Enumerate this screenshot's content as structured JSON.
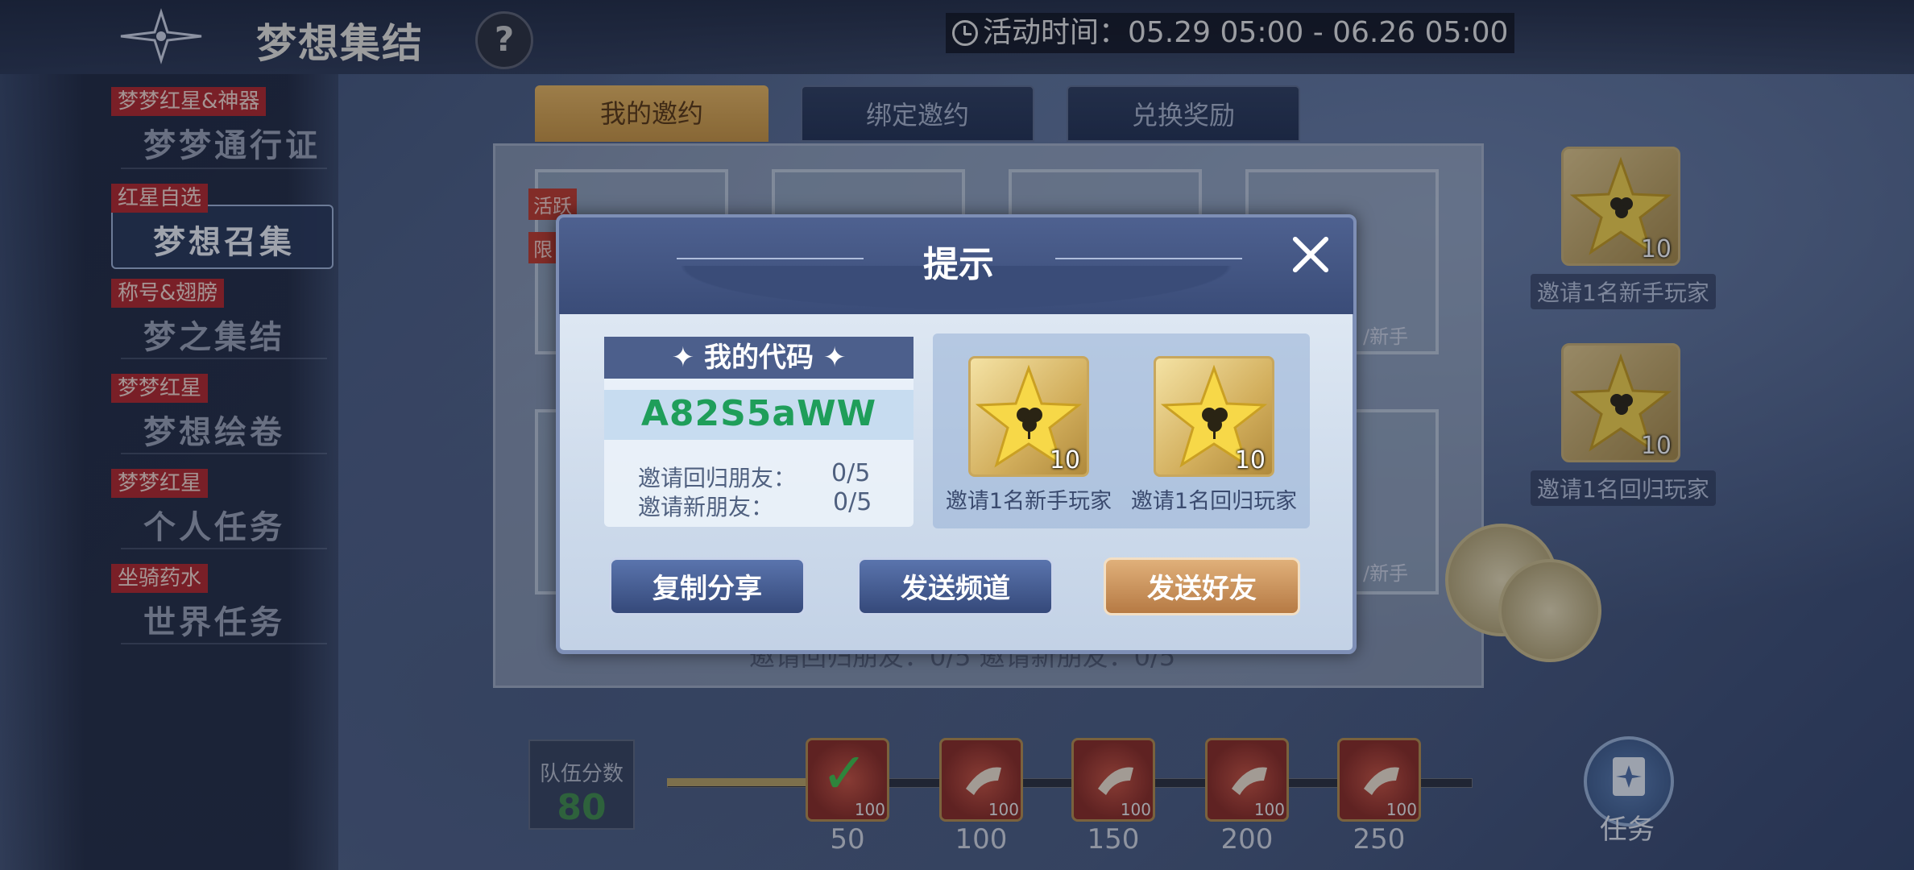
{
  "header": {
    "title": "梦想集结",
    "help_icon": "?",
    "event_time": "活动时间：05.29 05:00 - 06.26 05:00"
  },
  "sidebar": {
    "items": [
      {
        "tag": "梦梦红星&神器",
        "label": "梦梦通行证",
        "active": false
      },
      {
        "tag": "红星自选",
        "label": "梦想召集",
        "active": true
      },
      {
        "tag": "称号&翅膀",
        "label": "梦之集结",
        "active": false
      },
      {
        "tag": "梦梦红星",
        "label": "梦想绘卷",
        "active": false
      },
      {
        "tag": "梦梦红星",
        "label": "个人任务",
        "active": false
      },
      {
        "tag": "坐骑药水",
        "label": "世界任务",
        "active": false
      }
    ]
  },
  "tabs": [
    {
      "label": "我的邀约",
      "active": true
    },
    {
      "label": "绑定邀约",
      "active": false
    },
    {
      "label": "兑换奖励",
      "active": false
    }
  ],
  "background": {
    "tag_active": "活跃",
    "tag_2": "限",
    "side_text_1": "/新手",
    "side_text_2": "/新手",
    "under_text": "邀请回归朋友：0/5      邀请新朋友：0/5",
    "right_rewards": [
      {
        "count": "10",
        "label": "邀请1名新手玩家"
      },
      {
        "count": "10",
        "label": "邀请1名回归玩家"
      }
    ]
  },
  "progress": {
    "team_score_label": "队伍分数",
    "team_score": "80",
    "fill_fraction": 0.22,
    "milestones": [
      {
        "score": "50",
        "reward_count": "100",
        "claimed": true
      },
      {
        "score": "100",
        "reward_count": "100",
        "claimed": false
      },
      {
        "score": "150",
        "reward_count": "100",
        "claimed": false
      },
      {
        "score": "200",
        "reward_count": "100",
        "claimed": false
      },
      {
        "score": "250",
        "reward_count": "100",
        "claimed": false
      }
    ],
    "task_label": "任务"
  },
  "dialog": {
    "title": "提示",
    "code_header": "✦ 我的代码 ✦",
    "code": "A82S5aWW",
    "returning_friends_label": "邀请回归朋友：",
    "returning_friends_value": "0/5",
    "new_friends_label": "邀请新朋友：",
    "new_friends_value": "0/5",
    "rewards": [
      {
        "count": "10",
        "label": "邀请1名新手玩家",
        "icon": "clover-star-icon"
      },
      {
        "count": "10",
        "label": "邀请1名回归玩家",
        "icon": "clover-star-icon"
      }
    ],
    "buttons": {
      "copy_share": "复制分享",
      "send_channel": "发送频道",
      "send_friend": "发送好友"
    }
  },
  "colors": {
    "code_green": "#1f9e5a",
    "tag_red": "#b2262a",
    "active_tab_gold": "#e9b65e",
    "dialog_header": "#4e6190"
  }
}
